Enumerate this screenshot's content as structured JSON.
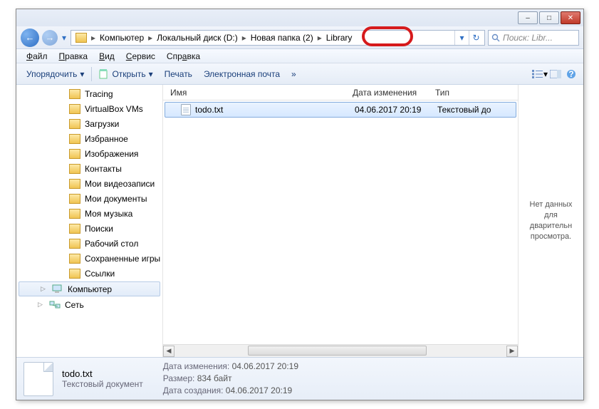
{
  "window": {
    "minimize": "–",
    "maximize": "□",
    "close": "✕"
  },
  "nav": {
    "back": "←",
    "forward": "→",
    "dropdown": "▾",
    "history": "▾",
    "refresh": "↻"
  },
  "breadcrumb": {
    "root": "Компьютер",
    "disk": "Локальный диск (D:)",
    "folder": "Новая папка (2)",
    "current": "Library",
    "sep": "▸"
  },
  "search": {
    "placeholder": "Поиск: Libr..."
  },
  "menu": {
    "file": "Файл",
    "file_u": "Ф",
    "edit": "Правка",
    "edit_u": "П",
    "view": "Вид",
    "view_u": "В",
    "tools": "Сервис",
    "tools_u": "С",
    "help": "Справка",
    "help_u": "а"
  },
  "toolbar": {
    "organize": "Упорядочить",
    "open": "Открыть",
    "print": "Печать",
    "email": "Электронная почта",
    "more": "»"
  },
  "tree": {
    "items": [
      {
        "label": "Tracing",
        "icon": "folder",
        "lvl": 2
      },
      {
        "label": "VirtualBox VMs",
        "icon": "folder",
        "lvl": 2
      },
      {
        "label": "Загрузки",
        "icon": "folder",
        "lvl": 2
      },
      {
        "label": "Избранное",
        "icon": "folder",
        "lvl": 2
      },
      {
        "label": "Изображения",
        "icon": "folder",
        "lvl": 2
      },
      {
        "label": "Контакты",
        "icon": "folder",
        "lvl": 2
      },
      {
        "label": "Мои видеозаписи",
        "icon": "folder",
        "lvl": 2
      },
      {
        "label": "Мои документы",
        "icon": "folder",
        "lvl": 2
      },
      {
        "label": "Моя музыка",
        "icon": "folder",
        "lvl": 2
      },
      {
        "label": "Поиски",
        "icon": "folder",
        "lvl": 2
      },
      {
        "label": "Рабочий стол",
        "icon": "folder",
        "lvl": 2
      },
      {
        "label": "Сохраненные игры",
        "icon": "folder",
        "lvl": 2
      },
      {
        "label": "Ссылки",
        "icon": "folder",
        "lvl": 2
      }
    ],
    "computer": "Компьютер",
    "network": "Сеть"
  },
  "columns": {
    "name": "Имя",
    "modified": "Дата изменения",
    "type": "Тип"
  },
  "files": [
    {
      "name": "todo.txt",
      "modified": "04.06.2017 20:19",
      "type": "Текстовый до"
    }
  ],
  "preview": {
    "empty": "Нет данных для дварительн просмотра."
  },
  "details": {
    "name": "todo.txt",
    "type": "Текстовый документ",
    "modified_label": "Дата изменения:",
    "modified": "04.06.2017 20:19",
    "size_label": "Размер:",
    "size": "834 байт",
    "created_label": "Дата создания:",
    "created": "04.06.2017 20:19"
  },
  "colors": {
    "accent": "#2f6fc4",
    "highlight": "#d61a1c"
  }
}
